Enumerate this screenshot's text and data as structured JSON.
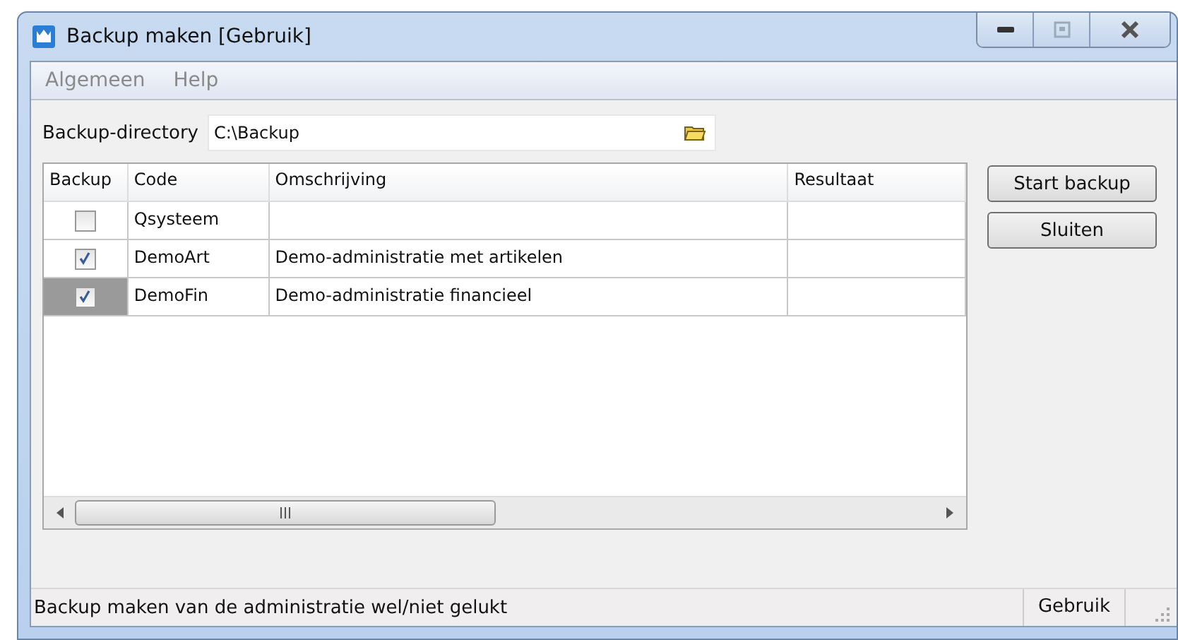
{
  "window": {
    "title": "Backup maken  [Gebruik]"
  },
  "menu": [
    "Algemeen",
    "Help"
  ],
  "directory": {
    "label": "Backup-directory",
    "value": "C:\\Backup"
  },
  "table": {
    "columns": [
      "Backup",
      "Code",
      "Omschrijving",
      "Resultaat"
    ],
    "rows": [
      {
        "checked": false,
        "code": "Qsysteem",
        "description": "",
        "selected": false
      },
      {
        "checked": true,
        "code": "DemoArt",
        "description": "Demo-administratie met artikelen",
        "selected": false
      },
      {
        "checked": true,
        "code": "DemoFin",
        "description": "Demo-administratie financieel",
        "selected": true
      }
    ]
  },
  "buttons": [
    "Start backup",
    "Sluiten"
  ],
  "status_bar": {
    "message": "Backup maken van de administratie wel/niet gelukt",
    "mode": "Gebruik"
  }
}
